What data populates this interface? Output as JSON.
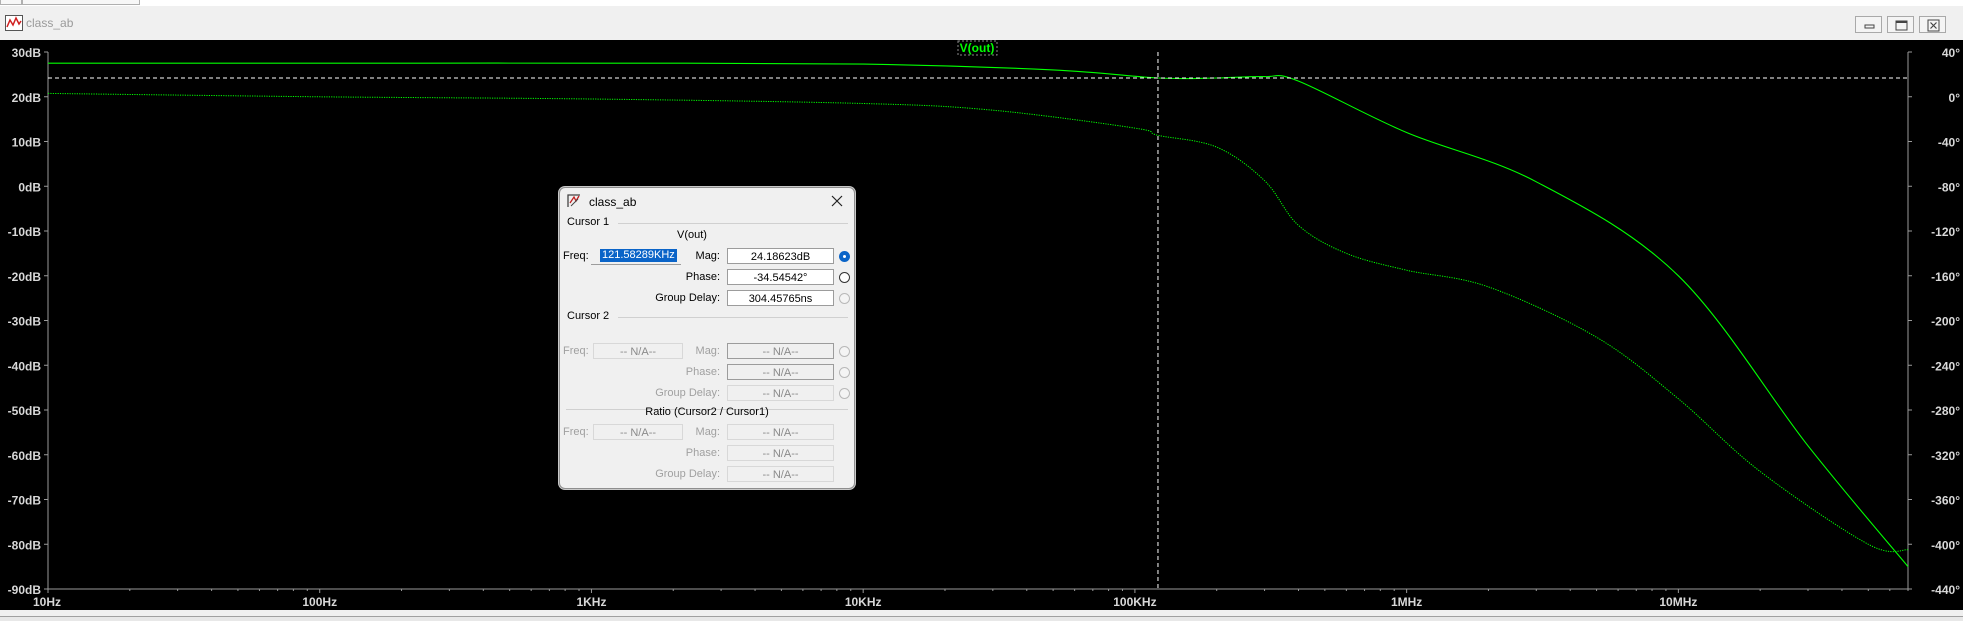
{
  "window": {
    "title": "class_ab"
  },
  "plot": {
    "trace_label": "V(out)",
    "trace_color": "#00ff00",
    "left_axis_labels": [
      "30dB",
      "20dB",
      "10dB",
      "0dB",
      "-10dB",
      "-20dB",
      "-30dB",
      "-40dB",
      "-50dB",
      "-60dB",
      "-70dB",
      "-80dB",
      "-90dB"
    ],
    "right_axis_labels": [
      "40°",
      "0°",
      "-40°",
      "-80°",
      "-120°",
      "-160°",
      "-200°",
      "-240°",
      "-280°",
      "-320°",
      "-360°",
      "-400°",
      "-440°"
    ],
    "x_axis_labels": [
      "10Hz",
      "100Hz",
      "1KHz",
      "10KHz",
      "100KHz",
      "1MHz",
      "10MHz"
    ]
  },
  "chart_data": {
    "type": "line",
    "x_scale": "log",
    "xlim": [
      10,
      70000000
    ],
    "ylim": [
      -90,
      30
    ],
    "y2lim": [
      -440,
      40
    ],
    "x_tick_labels": [
      "10Hz",
      "100Hz",
      "1KHz",
      "10KHz",
      "100KHz",
      "1MHz",
      "10MHz"
    ],
    "y_tick_labels": [
      "30dB",
      "20dB",
      "10dB",
      "0dB",
      "-10dB",
      "-20dB",
      "-30dB",
      "-40dB",
      "-50dB",
      "-60dB",
      "-70dB",
      "-80dB",
      "-90dB"
    ],
    "y2_tick_labels": [
      "40°",
      "0°",
      "-40°",
      "-80°",
      "-120°",
      "-160°",
      "-200°",
      "-240°",
      "-280°",
      "-320°",
      "-360°",
      "-400°",
      "-440°"
    ],
    "series": [
      {
        "name": "V(out)",
        "axis": "y",
        "style": "solid",
        "x": [
          10,
          100,
          1000,
          10000,
          50000,
          121583,
          200000,
          300000,
          400000,
          1000000,
          3000000,
          10000000,
          30000000,
          70000000
        ],
        "y": [
          27.5,
          27.5,
          27.5,
          27.3,
          26.0,
          24.2,
          24.2,
          24.5,
          23.5,
          12.0,
          1.0,
          -20.0,
          -58.0,
          -85.0
        ]
      },
      {
        "name": "V(out)",
        "axis": "y2",
        "style": "dotted",
        "x": [
          10,
          100,
          1000,
          10000,
          30000,
          100000,
          121583,
          200000,
          300000,
          400000,
          600000,
          1000000,
          2000000,
          5000000,
          10000000,
          20000000,
          50000000,
          70000000
        ],
        "y": [
          3,
          0,
          -2,
          -6,
          -12,
          -28,
          -34.5,
          -45,
          -75,
          -115,
          -140,
          -155,
          -170,
          -215,
          -270,
          -335,
          -400,
          -405
        ]
      }
    ],
    "cursor": {
      "x": 121583,
      "y": 24.18623
    }
  },
  "dialog": {
    "title": "class_ab",
    "cursor1": {
      "heading": "Cursor 1",
      "trace": "V(out)",
      "freq_label": "Freq:",
      "freq": "121.58289KHz",
      "mag_label": "Mag:",
      "mag": "24.18623dB",
      "phase_label": "Phase:",
      "phase": "-34.54542°",
      "gd_label": "Group Delay:",
      "gd": "304.45765ns"
    },
    "cursor2": {
      "heading": "Cursor 2",
      "freq_label": "Freq:",
      "freq": "-- N/A--",
      "mag_label": "Mag:",
      "mag": "-- N/A--",
      "phase_label": "Phase:",
      "phase": "-- N/A--",
      "gd_label": "Group Delay:",
      "gd": "-- N/A--"
    },
    "ratio": {
      "heading": "Ratio (Cursor2 / Cursor1)",
      "freq_label": "Freq:",
      "freq": "-- N/A--",
      "mag_label": "Mag:",
      "mag": "-- N/A--",
      "phase_label": "Phase:",
      "phase": "-- N/A--",
      "gd_label": "Group Delay:",
      "gd": "-- N/A--"
    }
  }
}
